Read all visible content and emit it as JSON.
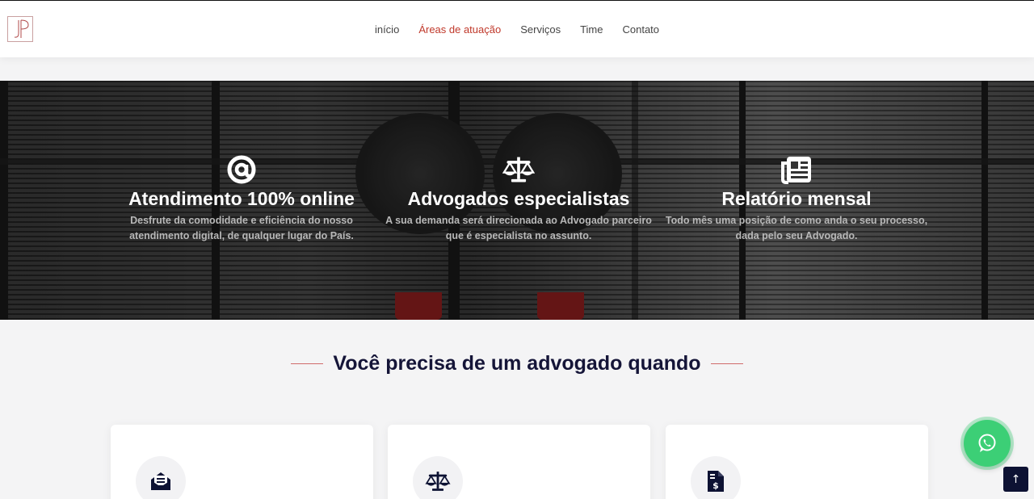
{
  "header": {
    "logo_text": "JP",
    "nav": [
      {
        "label": "início",
        "active": false
      },
      {
        "label": "Áreas de atuação",
        "active": true
      },
      {
        "label": "Serviços",
        "active": false
      },
      {
        "label": "Time",
        "active": false
      },
      {
        "label": "Contato",
        "active": false
      }
    ]
  },
  "hero": {
    "features": [
      {
        "icon": "at-icon",
        "title": "Atendimento 100% online",
        "text": "Desfrute da comodidade e eficiência do nosso atendimento digital, de qualquer lugar do País."
      },
      {
        "icon": "scales-icon",
        "title": "Advogados especialistas",
        "text": "A sua demanda será direcionada ao Advogado parceiro que é especialista no assunto."
      },
      {
        "icon": "newspaper-icon",
        "title": "Relatório mensal",
        "text": "Todo mês uma posição de como anda o seu processo, dada pelo seu Advogado."
      }
    ]
  },
  "section": {
    "title": "Você precisa de um advogado quando"
  },
  "cards": [
    {
      "icon": "envelope-icon"
    },
    {
      "icon": "scales-icon"
    },
    {
      "icon": "invoice-dollar-icon"
    }
  ],
  "floating": {
    "whatsapp_icon": "whatsapp-icon",
    "back_to_top_icon": "arrow-up-icon"
  },
  "colors": {
    "accent": "#c0392b",
    "title": "#151538",
    "whatsapp": "#3ccf76",
    "totop": "#0d1233"
  }
}
